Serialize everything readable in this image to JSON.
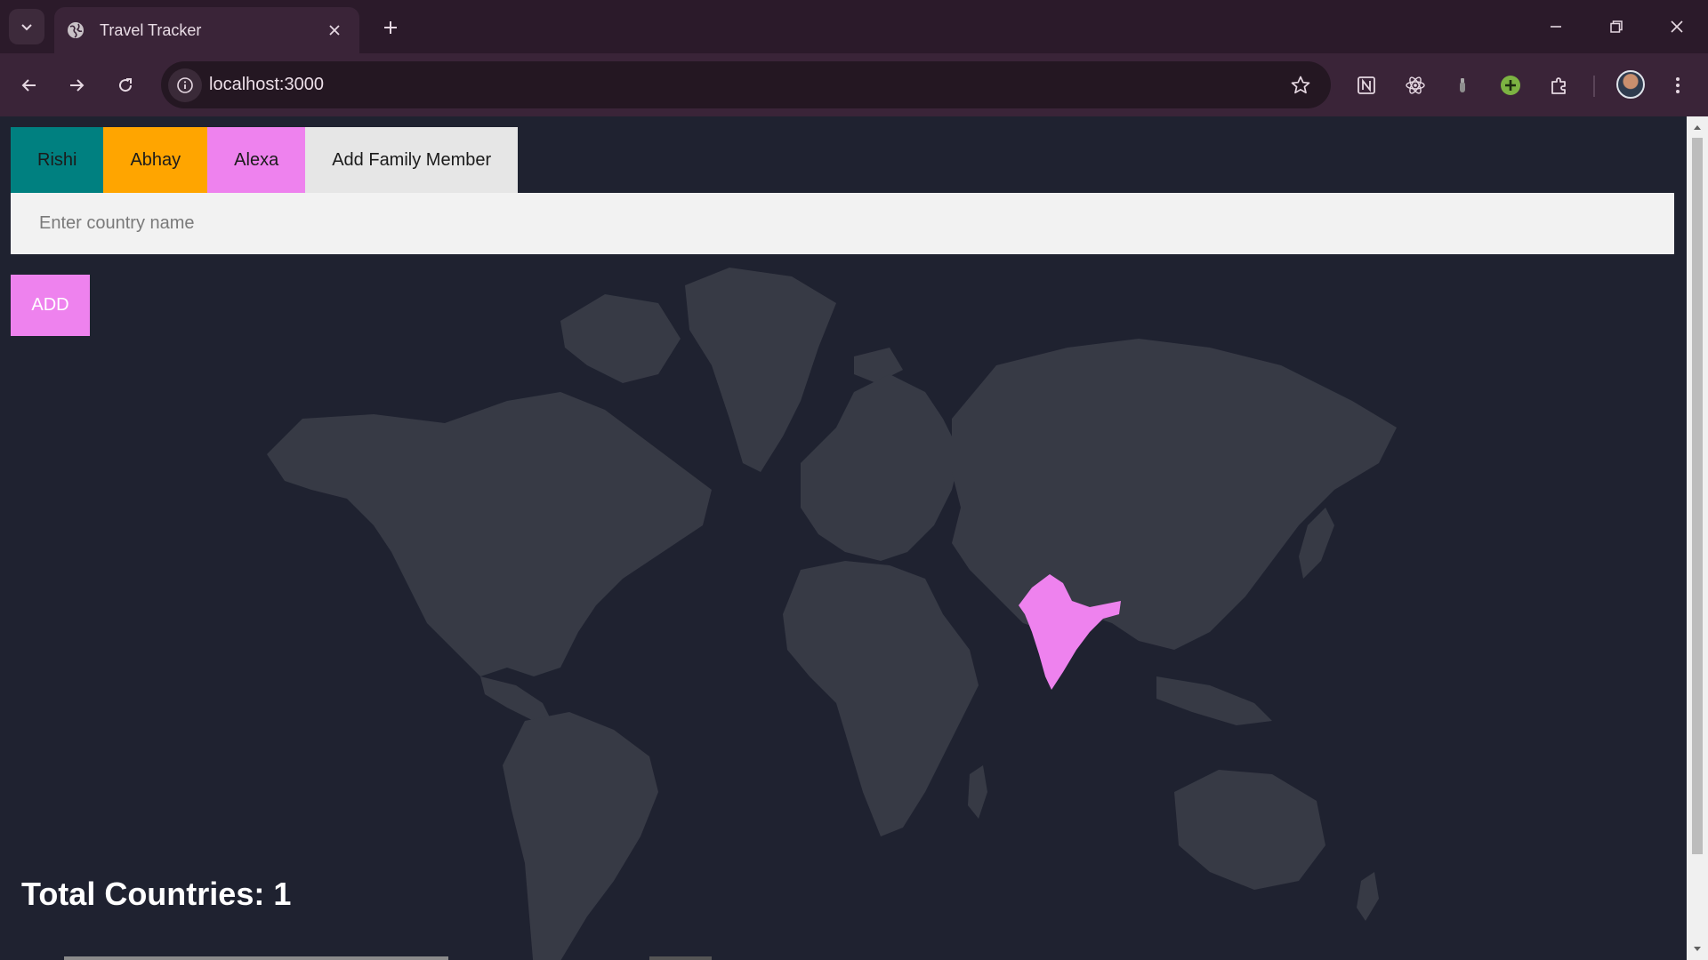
{
  "browser": {
    "tab": {
      "title": "Travel Tracker"
    },
    "address_bar": {
      "url": "localhost:3000"
    },
    "icons": {
      "tab_search": "chevron-down-icon",
      "favicon": "globe-icon",
      "tab_close": "close-icon",
      "new_tab": "plus-icon",
      "minimize": "minimize-icon",
      "restore": "restore-icon",
      "close_window": "close-icon",
      "back": "back-arrow-icon",
      "forward": "forward-arrow-icon",
      "reload": "reload-icon",
      "site_info": "info-icon",
      "bookmark": "star-icon",
      "extensions": [
        "notion-icon",
        "react-devtools-icon",
        "bottle-icon",
        "green-plus-icon",
        "puzzle-icon"
      ],
      "profile": "avatar",
      "menu": "kebab-menu-icon"
    }
  },
  "family": {
    "members": [
      {
        "name": "Rishi",
        "color": "#008080"
      },
      {
        "name": "Abhay",
        "color": "#ffa500"
      },
      {
        "name": "Alexa",
        "color": "#ee82ee"
      }
    ],
    "add_member_label": "Add Family Member",
    "add_member_bg": "#e6e6e6"
  },
  "form": {
    "country_placeholder": "Enter country name",
    "country_value": "",
    "add_label": "ADD"
  },
  "map": {
    "land_color": "#373a45",
    "visited_color": "#ee82ee",
    "visited_countries": [
      "India"
    ]
  },
  "summary": {
    "total_label": "Total Countries: ",
    "total_value": "1"
  }
}
